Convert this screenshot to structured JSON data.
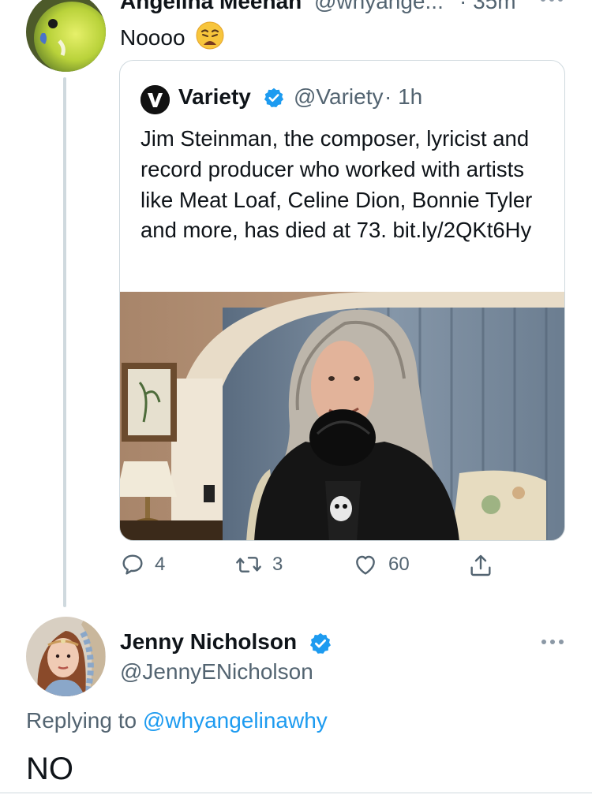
{
  "top_tweet": {
    "name": "Angelina Meehan",
    "handle": "@whyange...",
    "time": "· 35m",
    "text": "Noooo",
    "emoji": "😩"
  },
  "quoted_tweet": {
    "name": "Variety",
    "handle": "@Variety",
    "time": "· 1h",
    "text": "Jim Steinman, the composer, lyricist and record producer who worked with artists like Meat Loaf, Celine Dion, Bonnie Tyler and more, has died at 73. bit.ly/2QKt6Hy"
  },
  "actions": {
    "replies": "4",
    "retweets": "3",
    "likes": "60"
  },
  "reply_tweet": {
    "name": "Jenny Nicholson",
    "handle": "@JennyENicholson",
    "replying_prefix": "Replying to ",
    "replying_to": "@whyangelinawhy",
    "text": "NO"
  },
  "icons": {
    "verified": "verified-badge-icon",
    "reply": "reply-icon",
    "retweet": "retweet-icon",
    "like": "heart-icon",
    "share": "share-icon",
    "more": "more-icon"
  },
  "colors": {
    "accent": "#1d9bf0",
    "text": "#0f1419",
    "muted": "#536471",
    "border": "#cfd9de"
  }
}
